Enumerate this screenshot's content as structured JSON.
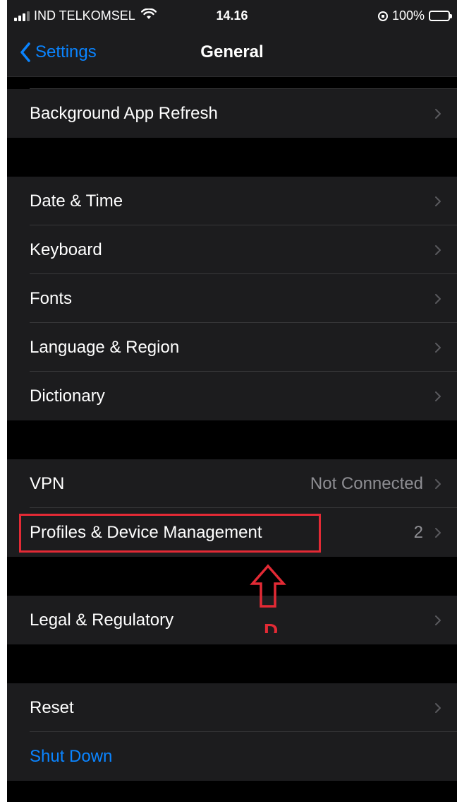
{
  "status_bar": {
    "carrier": "IND TELKOMSEL",
    "time": "14.16",
    "battery": "100%"
  },
  "nav": {
    "back_label": "Settings",
    "title": "General"
  },
  "groups": {
    "g1": [
      {
        "label": "Background App Refresh"
      }
    ],
    "g2": [
      {
        "label": "Date & Time"
      },
      {
        "label": "Keyboard"
      },
      {
        "label": "Fonts"
      },
      {
        "label": "Language & Region"
      },
      {
        "label": "Dictionary"
      }
    ],
    "g3": [
      {
        "label": "VPN",
        "detail": "Not Connected"
      },
      {
        "label": "Profiles & Device Management",
        "detail": "2"
      }
    ],
    "g4": [
      {
        "label": "Legal & Regulatory"
      }
    ],
    "g5": [
      {
        "label": "Reset"
      },
      {
        "label": "Shut Down"
      }
    ]
  },
  "annotation": {
    "letter": "D",
    "color": "#e32a35"
  },
  "colors": {
    "accent": "#0a84ff",
    "cell_bg": "#1c1c1e",
    "background": "#000000"
  }
}
